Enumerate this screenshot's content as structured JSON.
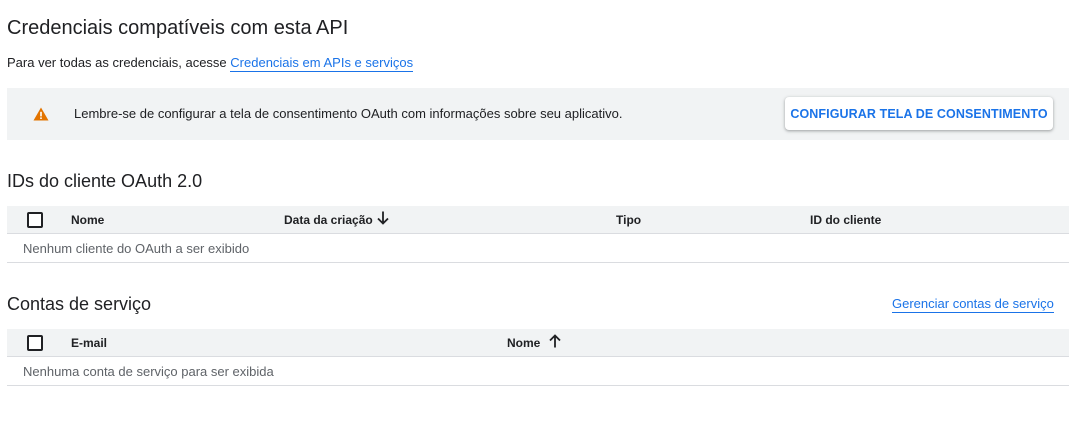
{
  "page": {
    "title": "Credenciais compatíveis com esta API",
    "subtitle_prefix": "Para ver todas as credenciais, acesse ",
    "subtitle_link": "Credenciais em APIs e serviços"
  },
  "banner": {
    "icon": "warning-icon",
    "text": "Lembre-se de configurar a tela de consentimento OAuth com informações sobre seu aplicativo.",
    "button_label": "CONFIGURAR TELA DE CONSENTIMENTO"
  },
  "oauth_section": {
    "title": "IDs do cliente OAuth 2.0",
    "columns": [
      "Nome",
      "Data da criação",
      "Tipo",
      "ID do cliente"
    ],
    "sorted_column": "Data da criação",
    "sort_direction": "descending",
    "empty_message": "Nenhum cliente do OAuth a ser exibido"
  },
  "service_section": {
    "title": "Contas de serviço",
    "manage_link": "Gerenciar contas de serviço",
    "columns": [
      "E-mail",
      "Nome"
    ],
    "sorted_column": "Nome",
    "sort_direction": "ascending",
    "empty_message": "Nenhuma conta de serviço para ser exibida"
  },
  "colors": {
    "accent": "#1a73e8",
    "warning": "#e37400",
    "banner_bg": "#f1f3f4",
    "text": "#202124",
    "muted_text": "#5f6368"
  }
}
